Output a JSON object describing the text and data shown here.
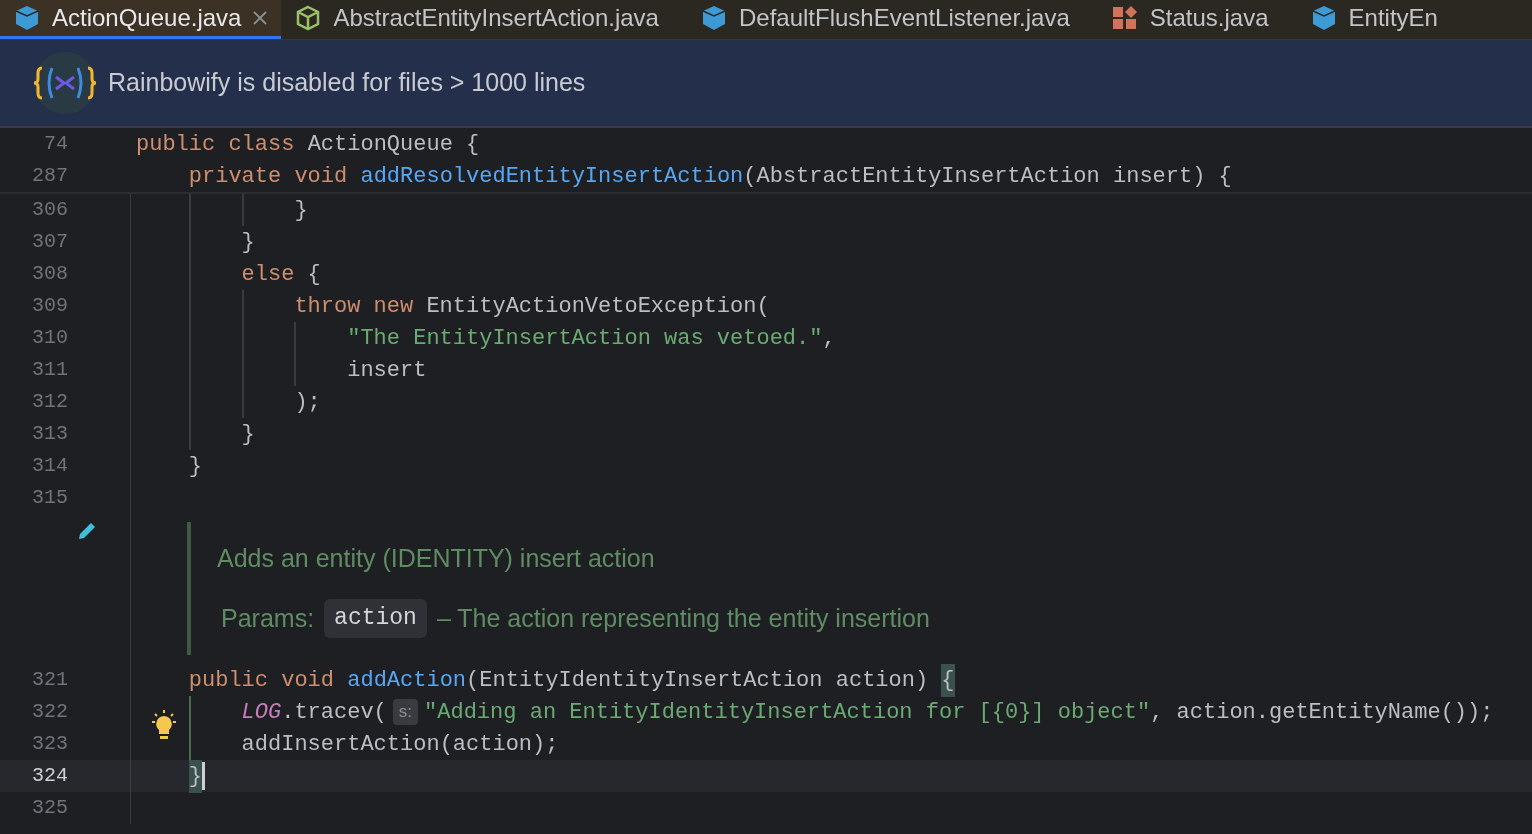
{
  "tabs": [
    {
      "label": "ActionQueue.java",
      "kind": "class",
      "selected": true,
      "closable": true
    },
    {
      "label": "AbstractEntityInsertAction.java",
      "kind": "abstract",
      "selected": false,
      "closable": false
    },
    {
      "label": "DefaultFlushEventListener.java",
      "kind": "class",
      "selected": false,
      "closable": false
    },
    {
      "label": "Status.java",
      "kind": "enum",
      "selected": false,
      "closable": false
    },
    {
      "label": "EntityEn",
      "kind": "class",
      "selected": false,
      "closable": false
    }
  ],
  "banner": {
    "text": "Rainbowify is disabled for files > 1000 lines"
  },
  "sticky_lines": [
    {
      "number": "74",
      "tokens": [
        {
          "kind": "kw",
          "text": "public class "
        },
        {
          "kind": "plain",
          "text": "ActionQueue {"
        }
      ]
    },
    {
      "number": "287",
      "tokens": [
        {
          "kind": "kw",
          "text": "    private void "
        },
        {
          "kind": "fn",
          "text": "addResolvedEntityInsertAction"
        },
        {
          "kind": "plain",
          "text": "(AbstractEntityInsertAction insert) {"
        }
      ]
    }
  ],
  "lines": [
    {
      "number": "306",
      "current": false,
      "tokens": [
        {
          "kind": "plain",
          "text": "            }"
        }
      ]
    },
    {
      "number": "307",
      "current": false,
      "tokens": [
        {
          "kind": "plain",
          "text": "        }"
        }
      ]
    },
    {
      "number": "308",
      "current": false,
      "tokens": [
        {
          "kind": "kw",
          "text": "        else "
        },
        {
          "kind": "plain",
          "text": "{"
        }
      ]
    },
    {
      "number": "309",
      "current": false,
      "tokens": [
        {
          "kind": "kw",
          "text": "            throw new "
        },
        {
          "kind": "plain",
          "text": "EntityActionVetoException("
        }
      ]
    },
    {
      "number": "310",
      "current": false,
      "tokens": [
        {
          "kind": "str",
          "text": "                \"The EntityInsertAction was vetoed.\""
        },
        {
          "kind": "plain",
          "text": ","
        }
      ]
    },
    {
      "number": "311",
      "current": false,
      "tokens": [
        {
          "kind": "plain",
          "text": "                insert"
        }
      ]
    },
    {
      "number": "312",
      "current": false,
      "tokens": [
        {
          "kind": "plain",
          "text": "            );"
        }
      ]
    },
    {
      "number": "313",
      "current": false,
      "tokens": [
        {
          "kind": "plain",
          "text": "        }"
        }
      ]
    },
    {
      "number": "314",
      "current": false,
      "tokens": [
        {
          "kind": "plain",
          "text": "    }"
        }
      ]
    },
    {
      "number": "315",
      "current": false
    }
  ],
  "doc_comment": {
    "summary": "Adds an entity (IDENTITY) insert action",
    "params_label": "Params:",
    "param_name": "action",
    "param_description": "– The action representing the entity insertion"
  },
  "lines_after": [
    {
      "number": "321",
      "current": false,
      "tokens": [
        {
          "kind": "kw",
          "text": "    public void "
        },
        {
          "kind": "fn",
          "text": "addAction"
        },
        {
          "kind": "plain",
          "text": "(EntityIdentityInsertAction action) "
        },
        {
          "kind": "brace",
          "text": "{"
        }
      ]
    },
    {
      "number": "322",
      "current": false,
      "tokens": [
        {
          "kind": "static",
          "text": "        LOG"
        },
        {
          "kind": "plain",
          "text": ".tracev("
        },
        {
          "kind": "hint",
          "text": "s:"
        },
        {
          "kind": "str",
          "text": "\"Adding an EntityIdentityInsertAction for [{0}] object\""
        },
        {
          "kind": "plain",
          "text": ", action.getEntityName());"
        }
      ]
    },
    {
      "number": "323",
      "current": false,
      "tokens": [
        {
          "kind": "plain",
          "text": "        addInsertAction(action);"
        }
      ]
    },
    {
      "number": "324",
      "current": true,
      "tokens": [
        {
          "kind": "brace",
          "text": "    }"
        }
      ]
    },
    {
      "number": "325",
      "current": false
    }
  ]
}
